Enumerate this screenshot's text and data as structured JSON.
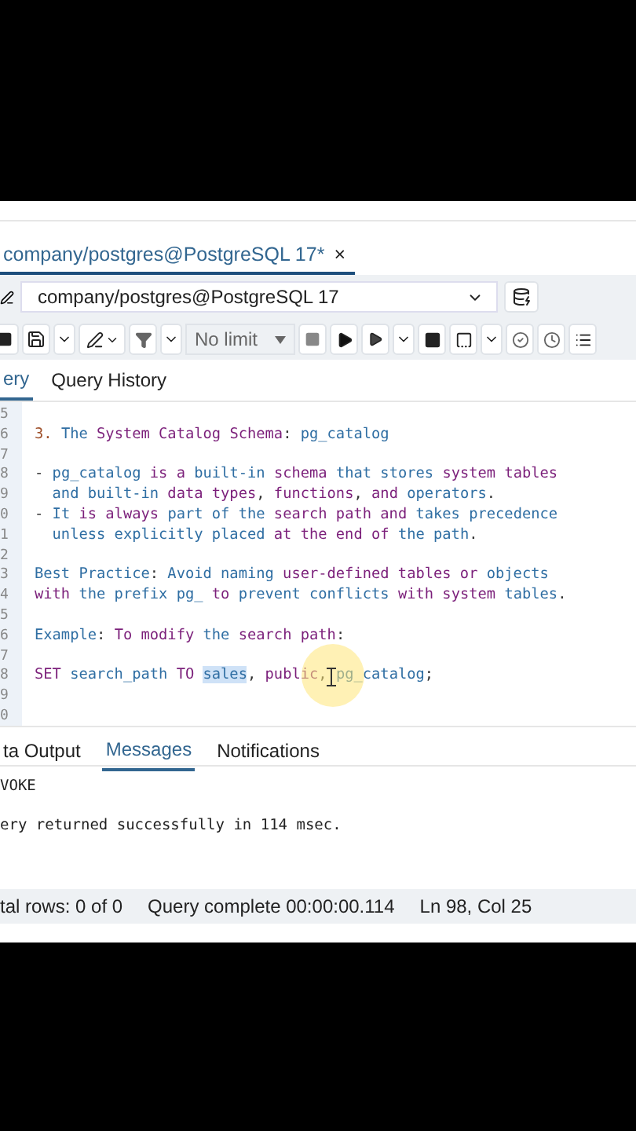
{
  "editor_tab": {
    "title": "company/postgres@PostgreSQL 17*",
    "close": "×",
    "selected": true
  },
  "connection": {
    "value": "company/postgres@PostgreSQL 17"
  },
  "toolbar": {
    "limit": "No limit"
  },
  "query_tabs": [
    {
      "label": "ery",
      "selected": true
    },
    {
      "label": "Query History",
      "selected": false
    }
  ],
  "code_lines": [
    {
      "number": "5"
    },
    {
      "number": "6",
      "tokens": [
        {
          "text": "3.",
          "kind": "number"
        },
        {
          "text": " The ",
          "kind": "identifier"
        },
        {
          "text": "System Catalog Schema",
          "kind": "keyword"
        },
        {
          "text": ": ",
          "kind": "punctuation"
        },
        {
          "text": "pg_catalog",
          "kind": "identifier"
        }
      ]
    },
    {
      "number": "7"
    },
    {
      "number": "8",
      "tokens": [
        {
          "text": "- ",
          "kind": "punctuation"
        },
        {
          "text": "pg_catalog ",
          "kind": "identifier"
        },
        {
          "text": "is a ",
          "kind": "keyword"
        },
        {
          "text": "built-in ",
          "kind": "identifier"
        },
        {
          "text": "schema ",
          "kind": "keyword"
        },
        {
          "text": "that stores ",
          "kind": "identifier"
        },
        {
          "text": "system tables",
          "kind": "keyword"
        }
      ]
    },
    {
      "number": "9",
      "tokens": [
        {
          "text": "  and built-in ",
          "kind": "identifier"
        },
        {
          "text": "data types",
          "kind": "keyword"
        },
        {
          "text": ", ",
          "kind": "punctuation"
        },
        {
          "text": "functions",
          "kind": "keyword"
        },
        {
          "text": ", ",
          "kind": "punctuation"
        },
        {
          "text": "and ",
          "kind": "keyword"
        },
        {
          "text": "operators",
          "kind": "identifier"
        },
        {
          "text": ".",
          "kind": "punctuation"
        }
      ]
    },
    {
      "number": "0",
      "tokens": [
        {
          "text": "- ",
          "kind": "punctuation"
        },
        {
          "text": "It ",
          "kind": "identifier"
        },
        {
          "text": "is always ",
          "kind": "keyword"
        },
        {
          "text": "part of the ",
          "kind": "identifier"
        },
        {
          "text": "search path and ",
          "kind": "keyword"
        },
        {
          "text": "takes precedence",
          "kind": "identifier"
        }
      ]
    },
    {
      "number": "1",
      "tokens": [
        {
          "text": "  unless explicitly placed ",
          "kind": "identifier"
        },
        {
          "text": "at the end of ",
          "kind": "keyword"
        },
        {
          "text": "the path",
          "kind": "identifier"
        },
        {
          "text": ".",
          "kind": "punctuation"
        }
      ]
    },
    {
      "number": "2"
    },
    {
      "number": "3",
      "tokens": [
        {
          "text": "Best Practice",
          "kind": "identifier"
        },
        {
          "text": ": ",
          "kind": "punctuation"
        },
        {
          "text": "Avoid naming ",
          "kind": "identifier"
        },
        {
          "text": "user-defined tables or ",
          "kind": "keyword"
        },
        {
          "text": "objects",
          "kind": "identifier"
        }
      ]
    },
    {
      "number": "4",
      "tokens": [
        {
          "text": "with ",
          "kind": "keyword"
        },
        {
          "text": "the prefix pg_ ",
          "kind": "identifier"
        },
        {
          "text": "to ",
          "kind": "keyword"
        },
        {
          "text": "prevent conflicts ",
          "kind": "identifier"
        },
        {
          "text": "with system ",
          "kind": "keyword"
        },
        {
          "text": "tables",
          "kind": "identifier"
        },
        {
          "text": ".",
          "kind": "punctuation"
        }
      ]
    },
    {
      "number": "5"
    },
    {
      "number": "6",
      "tokens": [
        {
          "text": "Example",
          "kind": "identifier"
        },
        {
          "text": ": ",
          "kind": "punctuation"
        },
        {
          "text": "To modify ",
          "kind": "keyword"
        },
        {
          "text": "the ",
          "kind": "identifier"
        },
        {
          "text": "search path",
          "kind": "keyword"
        },
        {
          "text": ":",
          "kind": "punctuation"
        }
      ]
    },
    {
      "number": "7"
    },
    {
      "number": "8",
      "tokens": [
        {
          "text": "SET ",
          "kind": "keyword"
        },
        {
          "text": "search_path ",
          "kind": "identifier"
        },
        {
          "text": "TO ",
          "kind": "keyword"
        },
        {
          "text": "sales",
          "kind": "selection"
        },
        {
          "text": ", ",
          "kind": "punctuation"
        },
        {
          "text": "public",
          "kind": "keyword"
        },
        {
          "text": ", ",
          "kind": "punctuation"
        },
        {
          "text": "pg_catalog",
          "kind": "identifier"
        },
        {
          "text": ";",
          "kind": "punctuation"
        }
      ]
    },
    {
      "number": "9"
    },
    {
      "number": "0"
    }
  ],
  "output_tabs": [
    {
      "label": "ta Output",
      "selected": false
    },
    {
      "label": "Messages",
      "selected": true
    },
    {
      "label": "Notifications",
      "selected": false
    }
  ],
  "messages": [
    "VOKE",
    "ery returned successfully in 114 msec."
  ],
  "status_bar": {
    "rows": "tal rows: 0 of 0",
    "query": "Query complete 00:00:00.114",
    "position": "Ln 98, Col 25"
  }
}
